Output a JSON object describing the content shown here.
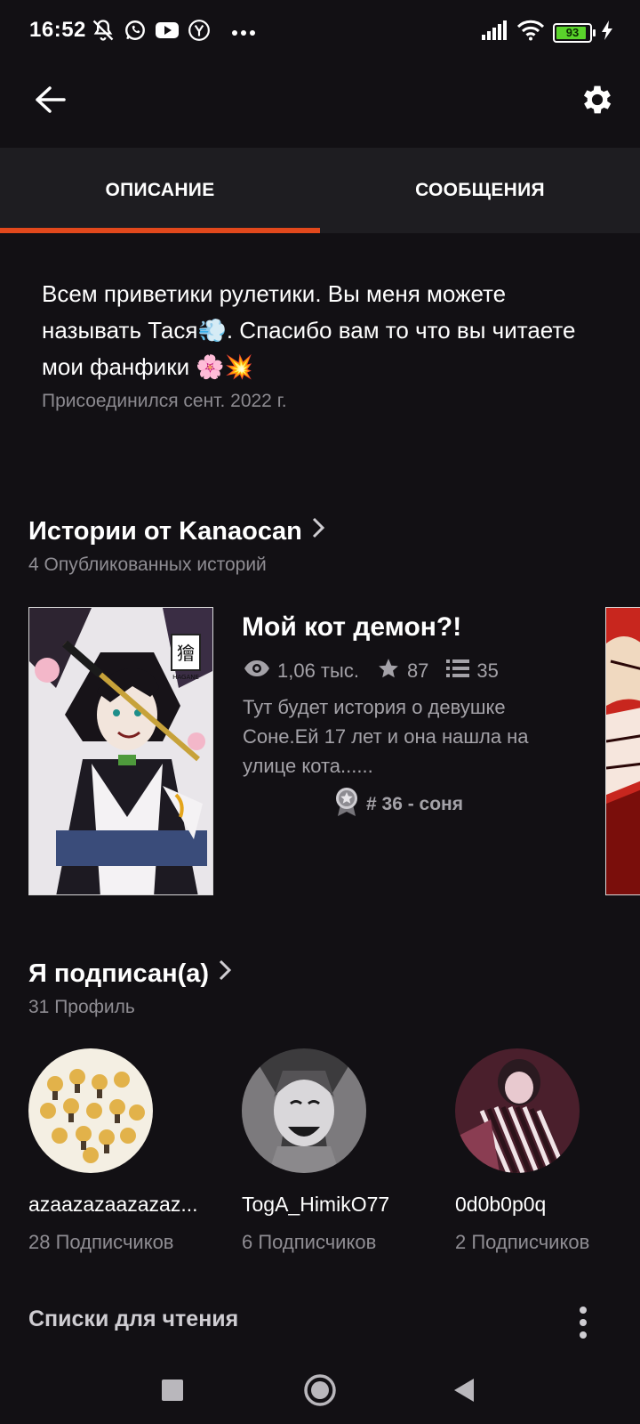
{
  "status_bar": {
    "time": "16:52",
    "battery": "93",
    "battery_level": 0.93,
    "icons_left": [
      "notifications-muted-icon",
      "whatsapp-icon",
      "youtube-icon",
      "yandex-icon",
      "more-dots-icon"
    ],
    "icons_right": [
      "signal-icon",
      "wifi-icon",
      "battery-icon",
      "charging-icon"
    ]
  },
  "app_bar": {
    "back_icon": "arrow-left-icon",
    "settings_icon": "gear-icon"
  },
  "tabs": [
    {
      "label": "ОПИСАНИЕ",
      "active": true
    },
    {
      "label": "СООБЩЕНИЯ",
      "active": false
    }
  ],
  "accent_color": "#e2481c",
  "about": {
    "text": "Всем приветики рулетики. Вы меня можете называть Тася💨. Спасибо вам то что вы читаете мои фанфики 🌸💥",
    "joined": "Присоединился сент. 2022 г."
  },
  "stories": {
    "title": "Истории от Kanaocan",
    "subtitle": "4 Опубликованных историй",
    "items": [
      {
        "title": "Мой кот демон?!",
        "views": "1,06 тыс.",
        "votes": "87",
        "parts": "35",
        "description": "Тут будет история о девушке Соне.Ей 17 лет и она нашла на улице кота......",
        "rank": "# 36 - соня",
        "cover_text": "HAGANE"
      }
    ]
  },
  "following": {
    "title": "Я подписан(а)",
    "subtitle": "31 Профиль",
    "items": [
      {
        "name": "azaazazaazazaz...",
        "followers": "28 Подписчиков"
      },
      {
        "name": "TogA_HimikO77",
        "followers": "6 Подписчиков"
      },
      {
        "name": "0d0b0p0q",
        "followers": "2 Подписчиков"
      }
    ]
  },
  "reading_lists": {
    "title": "Списки для чтения"
  },
  "nav_bar": {
    "buttons": [
      "recents-square-icon",
      "home-circle-icon",
      "back-triangle-icon"
    ]
  }
}
